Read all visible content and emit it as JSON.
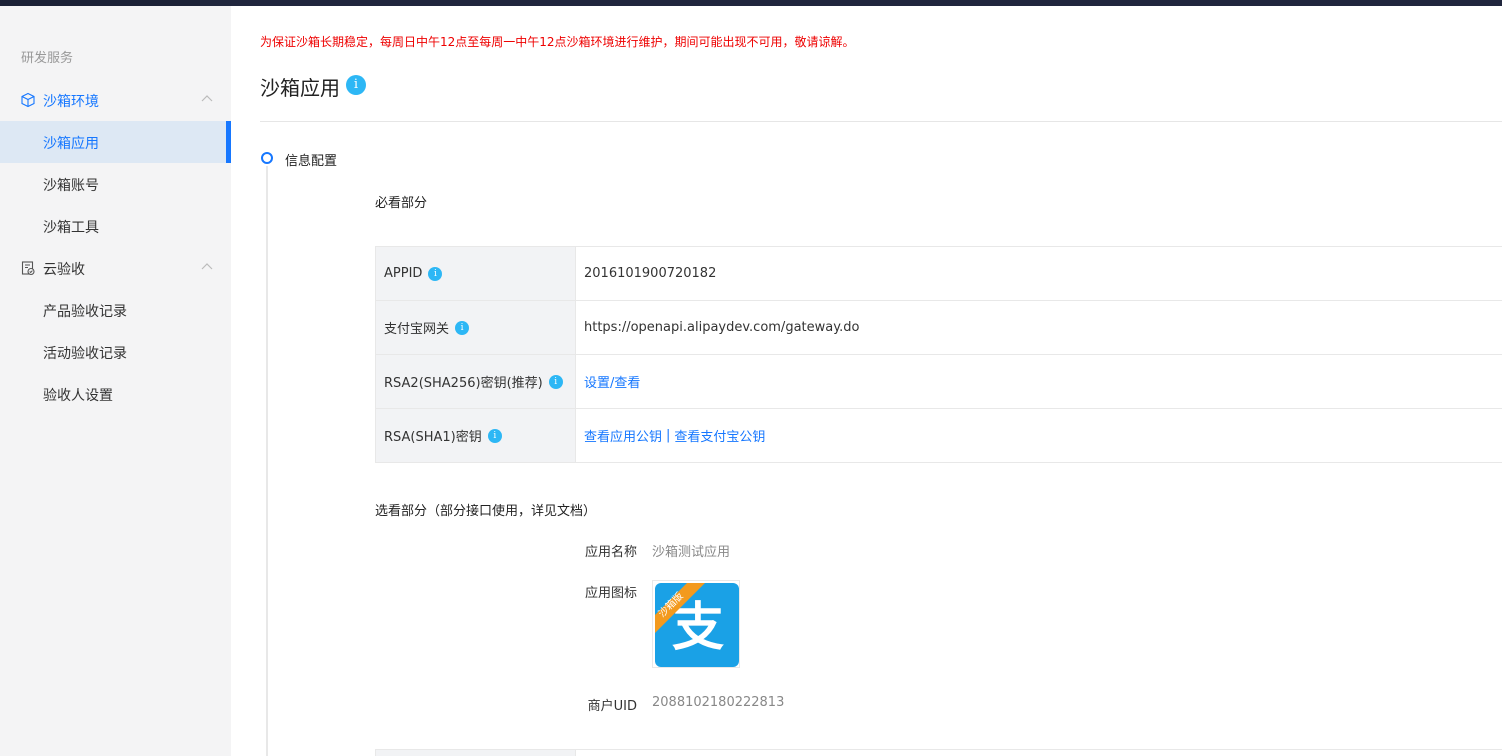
{
  "notice": "为保证沙箱长期稳定，每周日中午12点至每周一中午12点沙箱环境进行维护，期间可能出现不可用，敬请谅解。",
  "page_title": "沙箱应用",
  "title_info_icon": "i",
  "sidebar": {
    "section_title": "研发服务",
    "groups": [
      {
        "label": "沙箱环境",
        "icon": "cube-icon",
        "expanded": true,
        "items": [
          {
            "label": "沙箱应用",
            "active": true
          },
          {
            "label": "沙箱账号",
            "active": false
          },
          {
            "label": "沙箱工具",
            "active": false
          }
        ]
      },
      {
        "label": "云验收",
        "icon": "clipboard-check-icon",
        "expanded": true,
        "items": [
          {
            "label": "产品验收记录",
            "active": false
          },
          {
            "label": "活动验收记录",
            "active": false
          },
          {
            "label": "验收人设置",
            "active": false
          }
        ]
      }
    ]
  },
  "step": {
    "label": "信息配置"
  },
  "must_section": {
    "title": "必看部分",
    "rows": [
      {
        "key": "APPID",
        "value": "2016101900720182"
      },
      {
        "key": "支付宝网关",
        "value": "https://openapi.alipaydev.com/gateway.do"
      },
      {
        "key": "RSA2(SHA256)密钥(推荐)",
        "link": "设置/查看"
      },
      {
        "key": "RSA(SHA1)密钥",
        "link_a": "查看应用公钥",
        "separator": "|",
        "link_b": "查看支付宝公钥"
      }
    ]
  },
  "optional_section": {
    "title": "选看部分（部分接口使用，详见文档）",
    "app_name_label": "应用名称",
    "app_name_value": "沙箱测试应用",
    "app_icon_label": "应用图标",
    "app_icon_badge": "沙箱版",
    "app_icon_glyph": "支",
    "merchant_uid_label": "商户UID",
    "merchant_uid_value": "2088102180222813"
  },
  "colors": {
    "accent": "#1677ff",
    "notice": "#ee0000",
    "info_icon": "#2db7f5",
    "alipay_blue": "#1aa1e6",
    "badge_orange": "#f39a1e"
  }
}
